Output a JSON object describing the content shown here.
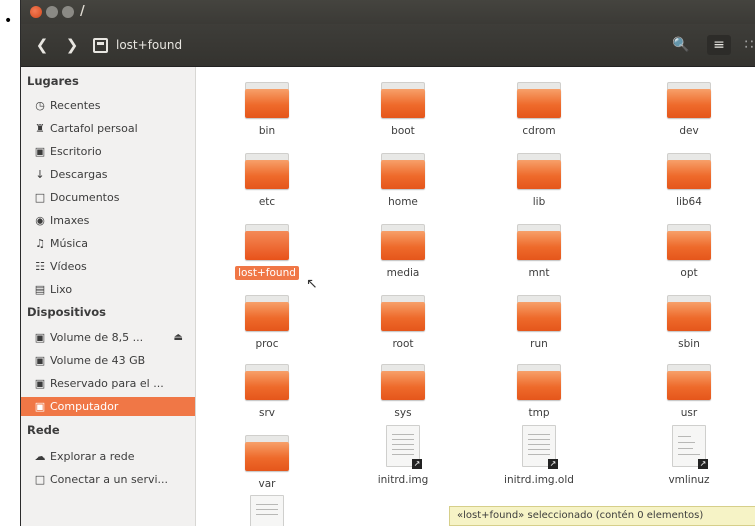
{
  "window": {
    "title": "/"
  },
  "toolbar": {
    "path_segment": "lost+found"
  },
  "sidebar": {
    "places_heading": "Lugares",
    "places": [
      {
        "label": "Recentes",
        "icon": "clock-icon"
      },
      {
        "label": "Cartafol persoal",
        "icon": "home-icon"
      },
      {
        "label": "Escritorio",
        "icon": "desktop-icon"
      },
      {
        "label": "Descargas",
        "icon": "download-icon"
      },
      {
        "label": "Documentos",
        "icon": "document-icon"
      },
      {
        "label": "Imaxes",
        "icon": "camera-icon"
      },
      {
        "label": "Música",
        "icon": "music-icon"
      },
      {
        "label": "Vídeos",
        "icon": "film-icon"
      },
      {
        "label": "Lixo",
        "icon": "trash-icon"
      }
    ],
    "devices_heading": "Dispositivos",
    "devices": [
      {
        "label": "Volume de 8,5 ...",
        "icon": "drive-icon"
      },
      {
        "label": "Volume de 43 GB",
        "icon": "drive-icon"
      },
      {
        "label": "Reservado para el ...",
        "icon": "drive-icon"
      },
      {
        "label": "Computador",
        "icon": "drive-icon",
        "active": true
      }
    ],
    "network_heading": "Rede",
    "network": [
      {
        "label": "Explorar a rede",
        "icon": "network-icon"
      },
      {
        "label": "Conectar a un servi...",
        "icon": "server-icon"
      }
    ]
  },
  "files": [
    {
      "name": "bin",
      "type": "folder"
    },
    {
      "name": "boot",
      "type": "folder"
    },
    {
      "name": "cdrom",
      "type": "folder"
    },
    {
      "name": "dev",
      "type": "folder"
    },
    {
      "name": "etc",
      "type": "folder"
    },
    {
      "name": "home",
      "type": "folder"
    },
    {
      "name": "lib",
      "type": "folder"
    },
    {
      "name": "lib64",
      "type": "folder"
    },
    {
      "name": "lost+found",
      "type": "folder",
      "selected": true
    },
    {
      "name": "media",
      "type": "folder"
    },
    {
      "name": "mnt",
      "type": "folder"
    },
    {
      "name": "opt",
      "type": "folder"
    },
    {
      "name": "proc",
      "type": "folder"
    },
    {
      "name": "root",
      "type": "folder"
    },
    {
      "name": "run",
      "type": "folder"
    },
    {
      "name": "sbin",
      "type": "folder"
    },
    {
      "name": "srv",
      "type": "folder"
    },
    {
      "name": "sys",
      "type": "folder"
    },
    {
      "name": "tmp",
      "type": "folder"
    },
    {
      "name": "usr",
      "type": "folder"
    },
    {
      "name": "var",
      "type": "folder"
    },
    {
      "name": "initrd.img",
      "type": "file"
    },
    {
      "name": "initrd.img.old",
      "type": "file"
    },
    {
      "name": "vmlinuz",
      "type": "file"
    },
    {
      "name": "",
      "type": "file"
    }
  ],
  "status": {
    "text": "«lost+found» seleccionado (contén 0 elementos)"
  },
  "colors": {
    "accent": "#f07746",
    "titlebar": "#3e3d39"
  }
}
